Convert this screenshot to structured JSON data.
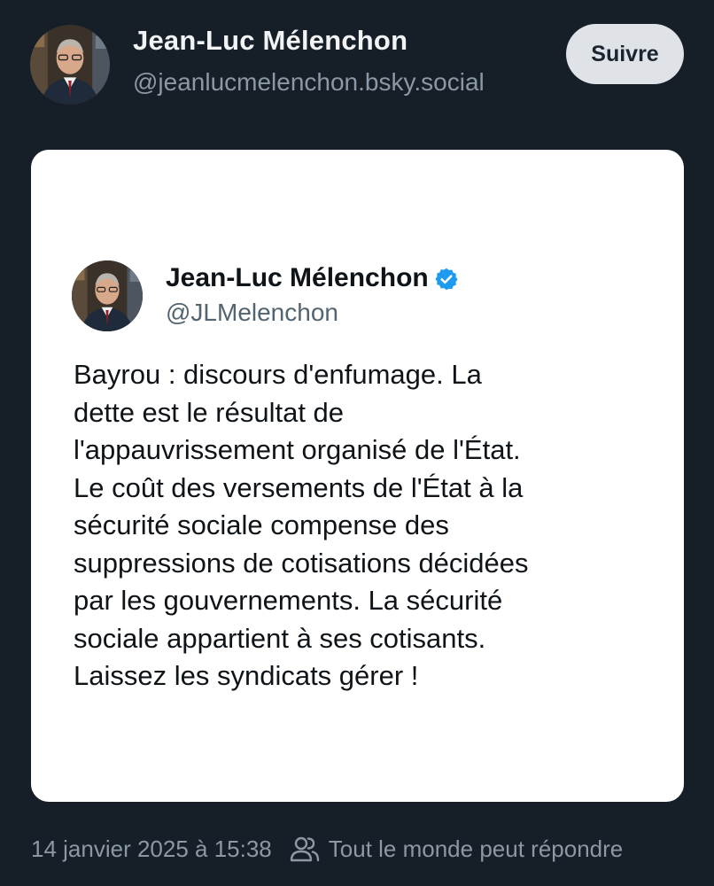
{
  "header": {
    "author_name": "Jean-Luc Mélenchon",
    "author_handle": "@jeanlucmelenchon.bsky.social",
    "follow_label": "Suivre",
    "avatar_icon": "profile-photo"
  },
  "embed": {
    "author_name": "Jean-Luc Mélenchon",
    "author_handle": "@JLMelenchon",
    "verified_icon": "verified-badge-icon",
    "verified_color": "#1d9bf0",
    "text_lines": [
      "Bayrou : discours d'enfumage. La",
      "dette est le résultat de",
      "l'appauvrissement organisé de l'État.",
      "Le coût des versements de l'État à la",
      "sécurité sociale compense des",
      "suppressions de cotisations décidées",
      "par les gouvernements. La sécurité",
      "sociale appartient à ses cotisants.",
      "Laissez les syndicats gérer !"
    ]
  },
  "footer": {
    "timestamp": "14 janvier 2025 à 15:38",
    "reply_setting": "Tout le monde peut répondre",
    "reply_icon": "people-icon"
  },
  "colors": {
    "background": "#161e27",
    "card": "#ffffff",
    "button": "#dfe3e8",
    "muted_text": "#8b98a5"
  }
}
